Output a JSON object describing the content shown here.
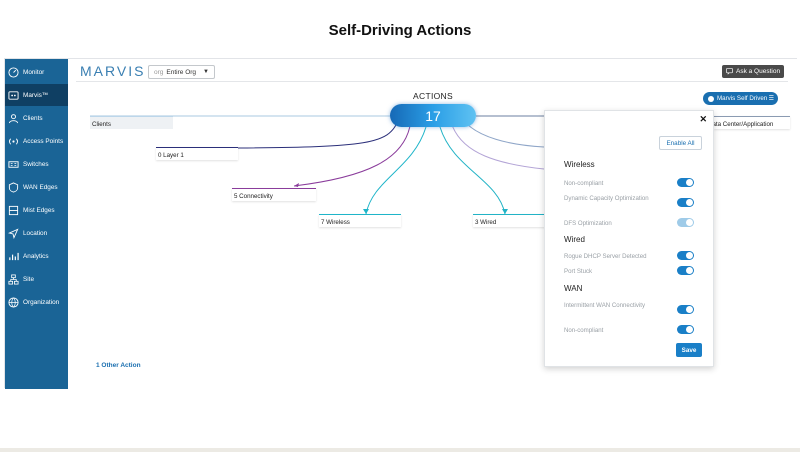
{
  "slide": {
    "title": "Self-Driving Actions"
  },
  "sidebar": {
    "items": [
      {
        "label": "Monitor",
        "icon": "monitor-icon"
      },
      {
        "label": "Marvis™",
        "icon": "marvis-icon",
        "active": true
      },
      {
        "label": "Clients",
        "icon": "clients-icon"
      },
      {
        "label": "Access Points",
        "icon": "access-points-icon"
      },
      {
        "label": "Switches",
        "icon": "switches-icon"
      },
      {
        "label": "WAN Edges",
        "icon": "wan-edges-icon"
      },
      {
        "label": "Mist Edges",
        "icon": "mist-edges-icon"
      },
      {
        "label": "Location",
        "icon": "location-icon"
      },
      {
        "label": "Analytics",
        "icon": "analytics-icon"
      },
      {
        "label": "Site",
        "icon": "site-icon"
      },
      {
        "label": "Organization",
        "icon": "organization-icon"
      }
    ]
  },
  "header": {
    "logo": "MARVIS",
    "org_prefix": "org",
    "org_value": "Entire Org",
    "ask_label": "Ask a Question"
  },
  "actions": {
    "label": "ACTIONS",
    "count": "17",
    "other_action": "1 Other Action",
    "mode_button": "Marvis Self Driven"
  },
  "nodes": {
    "clients": "Clients",
    "layer1": "0 Layer 1",
    "connectivity": "5 Connectivity",
    "wireless": "7 Wireless",
    "wired": "3 Wired",
    "datacenter": "Data Center/Application"
  },
  "panel": {
    "close": "✕",
    "enable_all": "Enable All",
    "save": "Save",
    "sections": [
      {
        "title": "Wireless",
        "options": [
          {
            "label": "Non-compliant",
            "enabled": true
          },
          {
            "label": "Dynamic Capacity Optimization",
            "enabled": true
          },
          {
            "label": "DFS Optimization",
            "enabled": true,
            "disabled": true
          }
        ]
      },
      {
        "title": "Wired",
        "options": [
          {
            "label": "Rogue DHCP Server Detected",
            "enabled": true
          },
          {
            "label": "Port Stuck",
            "enabled": true
          }
        ]
      },
      {
        "title": "WAN",
        "options": [
          {
            "label": "Intermittent WAN Connectivity",
            "enabled": true
          },
          {
            "label": "Non-compliant",
            "enabled": true
          }
        ]
      }
    ]
  },
  "colors": {
    "sidebar": "#1a6496",
    "sidebar_active": "#0f3f63",
    "accent": "#1a7fc7",
    "layer1_line": "#2b2f7a",
    "connectivity_line": "#8a3c9b",
    "wireless_line": "#1fb5c9",
    "wired_line": "#22b3c6"
  }
}
